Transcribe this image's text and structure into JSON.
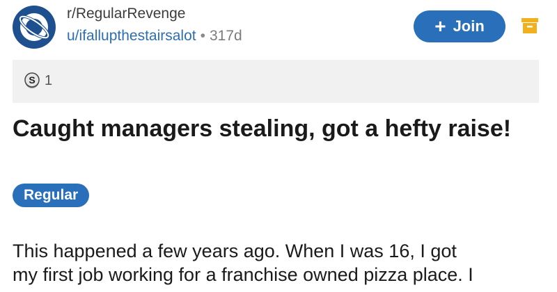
{
  "post": {
    "subreddit": "r/RegularRevenge",
    "username": "u/ifallupthestairsalot",
    "separator": "•",
    "age": "317d",
    "join_label": "Join",
    "award_count": "1",
    "title": "Caught managers stealing, got a hefty raise!",
    "flair": "Regular",
    "body_lines": [
      "This happened a few years ago. When I was 16, I got",
      "my first job working for a franchise owned pizza place. I"
    ]
  },
  "icons": {
    "avatar": "planet-icon",
    "join": "plus-icon",
    "archive": "archive-icon",
    "award": "silver-award-icon"
  },
  "colors": {
    "accent": "#2a6fba",
    "avatar_bg": "#1e4f8f",
    "archive": "#f2b01e",
    "award_bar_bg": "#f1f1f1"
  }
}
